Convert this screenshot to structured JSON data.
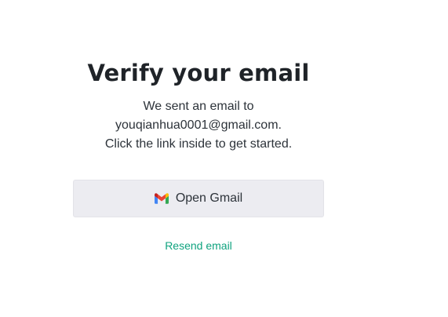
{
  "verify": {
    "title": "Verify your email",
    "message_line1": "We sent an email to",
    "email": "youqianhua0001@gmail.com.",
    "message_line3": "Click the link inside to get started."
  },
  "actions": {
    "open_gmail_label": "Open Gmail",
    "open_gmail_icon": "gmail-icon",
    "resend_label": "Resend email"
  },
  "colors": {
    "accent": "#10a37f",
    "button_bg": "#ececf1",
    "text": "#2d333a"
  }
}
